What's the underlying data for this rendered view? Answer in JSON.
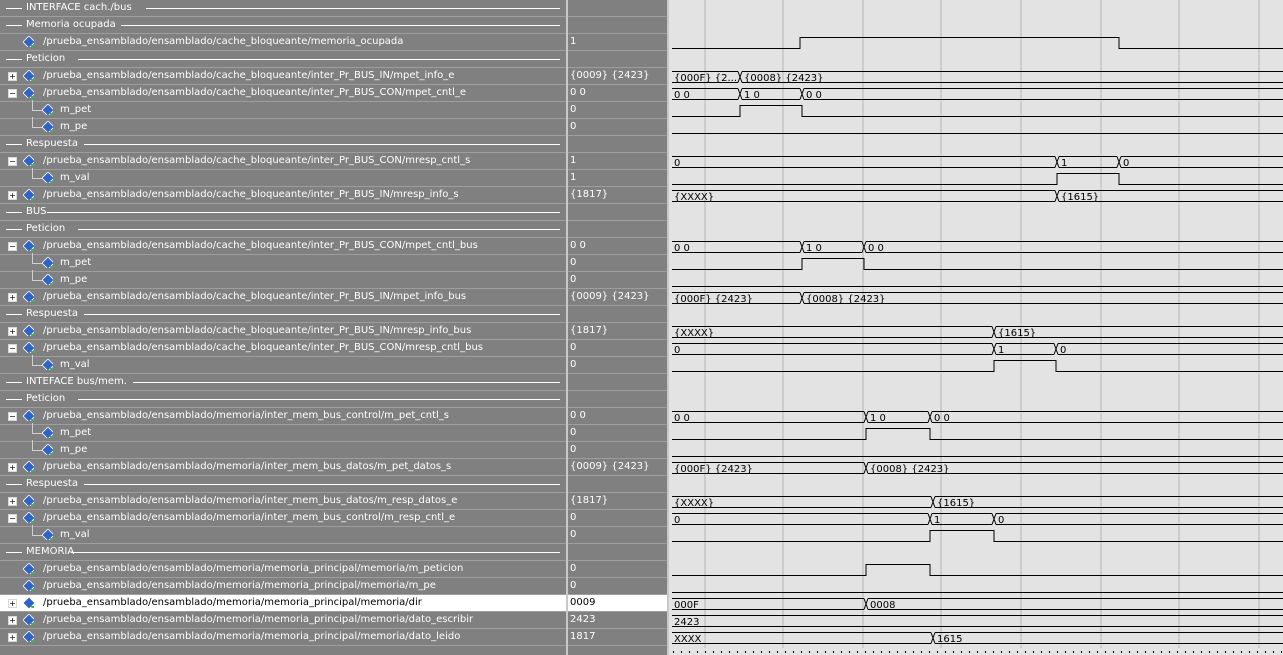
{
  "colors": {
    "panel": "#808080",
    "wave_bg": "#e3e3e3",
    "trace": "#000000",
    "icon": "#2f63c8",
    "icon_accent": "#3cb54a"
  },
  "icons": {
    "signal": "diamond-signal-icon",
    "expand": "plus-box-icon",
    "collapse": "minus-box-icon"
  },
  "rows": [
    {
      "type": "divider",
      "label": "INTERFACE cach./bus",
      "indent": 0
    },
    {
      "type": "divider",
      "label": "Memoria ocupada",
      "indent": 0
    },
    {
      "type": "signal",
      "name": "/prueba_ensamblado/ensamblado/cache_bloqueante/memoria_ocupada",
      "value": "1",
      "expand": "none"
    },
    {
      "type": "divider",
      "label": "Peticion",
      "indent": 0
    },
    {
      "type": "signal",
      "name": "/prueba_ensamblado/ensamblado/cache_bloqueante/inter_Pr_BUS_IN/mpet_info_e",
      "value": "{0009} {2423}",
      "expand": "plus"
    },
    {
      "type": "signal",
      "name": "/prueba_ensamblado/ensamblado/cache_bloqueante/inter_Pr_BUS_CON/mpet_cntl_e",
      "value": "0 0",
      "expand": "minus"
    },
    {
      "type": "child",
      "name": "m_pet",
      "value": "0"
    },
    {
      "type": "child",
      "name": "m_pe",
      "value": "0"
    },
    {
      "type": "divider",
      "label": "Respuesta",
      "indent": 0
    },
    {
      "type": "signal",
      "name": "/prueba_ensamblado/ensamblado/cache_bloqueante/inter_Pr_BUS_CON/mresp_cntl_s",
      "value": "1",
      "expand": "minus"
    },
    {
      "type": "child",
      "name": "m_val",
      "value": "1"
    },
    {
      "type": "signal",
      "name": "/prueba_ensamblado/ensamblado/cache_bloqueante/inter_Pr_BUS_IN/mresp_info_s",
      "value": "{1817}",
      "expand": "plus"
    },
    {
      "type": "divider",
      "label": "BUS",
      "indent": 0
    },
    {
      "type": "divider",
      "label": "Peticion",
      "indent": 0
    },
    {
      "type": "signal",
      "name": "/prueba_ensamblado/ensamblado/cache_bloqueante/inter_Pr_BUS_CON/mpet_cntl_bus",
      "value": "0 0",
      "expand": "minus"
    },
    {
      "type": "child",
      "name": "m_pet",
      "value": "0"
    },
    {
      "type": "child",
      "name": "m_pe",
      "value": "0"
    },
    {
      "type": "signal",
      "name": "/prueba_ensamblado/ensamblado/cache_bloqueante/inter_Pr_BUS_IN/mpet_info_bus",
      "value": "{0009} {2423}",
      "expand": "plus"
    },
    {
      "type": "divider",
      "label": "Respuesta",
      "indent": 0
    },
    {
      "type": "signal",
      "name": "/prueba_ensamblado/ensamblado/cache_bloqueante/inter_Pr_BUS_IN/mresp_info_bus",
      "value": "{1817}",
      "expand": "plus"
    },
    {
      "type": "signal",
      "name": "/prueba_ensamblado/ensamblado/cache_bloqueante/inter_Pr_BUS_CON/mresp_cntl_bus",
      "value": "0",
      "expand": "minus"
    },
    {
      "type": "child",
      "name": "m_val",
      "value": "0"
    },
    {
      "type": "divider",
      "label": "INTEFACE bus/mem.",
      "indent": 0
    },
    {
      "type": "divider",
      "label": "Peticion",
      "indent": 0
    },
    {
      "type": "signal",
      "name": "/prueba_ensamblado/ensamblado/memoria/inter_mem_bus_control/m_pet_cntl_s",
      "value": "0 0",
      "expand": "minus"
    },
    {
      "type": "child",
      "name": "m_pet",
      "value": "0"
    },
    {
      "type": "child",
      "name": "m_pe",
      "value": "0"
    },
    {
      "type": "signal",
      "name": "/prueba_ensamblado/ensamblado/memoria/inter_mem_bus_datos/m_pet_datos_s",
      "value": "{0009} {2423}",
      "expand": "plus"
    },
    {
      "type": "divider",
      "label": "Respuesta",
      "indent": 0
    },
    {
      "type": "signal",
      "name": "/prueba_ensamblado/ensamblado/memoria/inter_mem_bus_datos/m_resp_datos_e",
      "value": "{1817}",
      "expand": "plus"
    },
    {
      "type": "signal",
      "name": "/prueba_ensamblado/ensamblado/memoria/inter_mem_bus_control/m_resp_cntl_e",
      "value": "0",
      "expand": "minus"
    },
    {
      "type": "child",
      "name": "m_val",
      "value": "0"
    },
    {
      "type": "divider",
      "label": "MEMORIA",
      "indent": 0
    },
    {
      "type": "signal",
      "name": "/prueba_ensamblado/ensamblado/memoria/memoria_principal/memoria/m_peticion",
      "value": "0",
      "expand": "none"
    },
    {
      "type": "signal",
      "name": "/prueba_ensamblado/ensamblado/memoria/memoria_principal/memoria/m_pe",
      "value": "0",
      "expand": "none"
    },
    {
      "type": "signal",
      "name": "/prueba_ensamblado/ensamblado/memoria/memoria_principal/memoria/dir",
      "value": "0009",
      "expand": "plus",
      "selected": true
    },
    {
      "type": "signal",
      "name": "/prueba_ensamblado/ensamblado/memoria/memoria_principal/memoria/dato_escribir",
      "value": "2423",
      "expand": "plus"
    },
    {
      "type": "signal",
      "name": "/prueba_ensamblado/ensamblado/memoria/memoria_principal/memoria/dato_leido",
      "value": "1817",
      "expand": "plus"
    }
  ],
  "waves": [
    null,
    null,
    {
      "kind": "bit",
      "segs": [
        [
          0,
          128,
          0
        ],
        [
          128,
          447,
          1
        ],
        [
          447,
          614,
          0
        ]
      ]
    },
    null,
    {
      "kind": "bus",
      "segs": [
        [
          0,
          68,
          "{000F} {2..."
        ],
        [
          68,
          614,
          "{0008} {2423}"
        ]
      ]
    },
    {
      "kind": "bus",
      "segs": [
        [
          0,
          68,
          "0 0"
        ],
        [
          68,
          130,
          "1 0"
        ],
        [
          130,
          614,
          "0 0"
        ]
      ]
    },
    {
      "kind": "bit",
      "segs": [
        [
          0,
          68,
          0
        ],
        [
          68,
          130,
          1
        ],
        [
          130,
          614,
          0
        ]
      ]
    },
    {
      "kind": "bit",
      "segs": [
        [
          0,
          614,
          0
        ]
      ]
    },
    null,
    {
      "kind": "bus",
      "segs": [
        [
          0,
          385,
          "0"
        ],
        [
          385,
          447,
          "1"
        ],
        [
          447,
          614,
          "0"
        ]
      ]
    },
    {
      "kind": "bit",
      "segs": [
        [
          0,
          385,
          0
        ],
        [
          385,
          447,
          1
        ],
        [
          447,
          614,
          0
        ]
      ]
    },
    {
      "kind": "bus",
      "segs": [
        [
          0,
          385,
          "{XXXX}"
        ],
        [
          385,
          614,
          "{1615}"
        ]
      ]
    },
    null,
    null,
    {
      "kind": "bus",
      "segs": [
        [
          0,
          130,
          "0 0"
        ],
        [
          130,
          192,
          "1 0"
        ],
        [
          192,
          614,
          "0 0"
        ]
      ]
    },
    {
      "kind": "bit",
      "segs": [
        [
          0,
          130,
          0
        ],
        [
          130,
          192,
          1
        ],
        [
          192,
          614,
          0
        ]
      ]
    },
    {
      "kind": "bit",
      "segs": [
        [
          0,
          614,
          0
        ]
      ]
    },
    {
      "kind": "bus",
      "segs": [
        [
          0,
          130,
          "{000F} {2423}"
        ],
        [
          130,
          614,
          "{0008} {2423}"
        ]
      ]
    },
    null,
    {
      "kind": "bus",
      "segs": [
        [
          0,
          322,
          "{XXXX}"
        ],
        [
          322,
          614,
          "{1615}"
        ]
      ]
    },
    {
      "kind": "bus",
      "segs": [
        [
          0,
          322,
          "0"
        ],
        [
          322,
          384,
          "1"
        ],
        [
          384,
          614,
          "0"
        ]
      ]
    },
    {
      "kind": "bit",
      "segs": [
        [
          0,
          322,
          0
        ],
        [
          322,
          384,
          1
        ],
        [
          384,
          614,
          0
        ]
      ]
    },
    null,
    null,
    {
      "kind": "bus",
      "segs": [
        [
          0,
          194,
          "0 0"
        ],
        [
          194,
          258,
          "1 0"
        ],
        [
          258,
          614,
          "0 0"
        ]
      ]
    },
    {
      "kind": "bit",
      "segs": [
        [
          0,
          194,
          0
        ],
        [
          194,
          258,
          1
        ],
        [
          258,
          614,
          0
        ]
      ]
    },
    {
      "kind": "bit",
      "segs": [
        [
          0,
          614,
          0
        ]
      ]
    },
    {
      "kind": "bus",
      "segs": [
        [
          0,
          194,
          "{000F} {2423}"
        ],
        [
          194,
          614,
          "{0008} {2423}"
        ]
      ]
    },
    null,
    {
      "kind": "bus",
      "segs": [
        [
          0,
          261,
          "{XXXX}"
        ],
        [
          261,
          614,
          "{1615}"
        ]
      ]
    },
    {
      "kind": "bus",
      "segs": [
        [
          0,
          258,
          "0"
        ],
        [
          258,
          322,
          "1"
        ],
        [
          322,
          614,
          "0"
        ]
      ]
    },
    {
      "kind": "bit",
      "segs": [
        [
          0,
          258,
          0
        ],
        [
          258,
          322,
          1
        ],
        [
          322,
          614,
          0
        ]
      ]
    },
    null,
    {
      "kind": "bit",
      "segs": [
        [
          0,
          194,
          0
        ],
        [
          194,
          258,
          1
        ],
        [
          258,
          614,
          0
        ]
      ]
    },
    {
      "kind": "bit",
      "segs": [
        [
          0,
          614,
          0
        ]
      ]
    },
    {
      "kind": "bus",
      "segs": [
        [
          0,
          194,
          "000F"
        ],
        [
          194,
          614,
          "0008"
        ]
      ]
    },
    {
      "kind": "bus",
      "segs": [
        [
          0,
          614,
          "2423"
        ]
      ]
    },
    {
      "kind": "bus",
      "segs": [
        [
          0,
          261,
          "XXXX"
        ],
        [
          261,
          614,
          "1615"
        ]
      ]
    }
  ]
}
